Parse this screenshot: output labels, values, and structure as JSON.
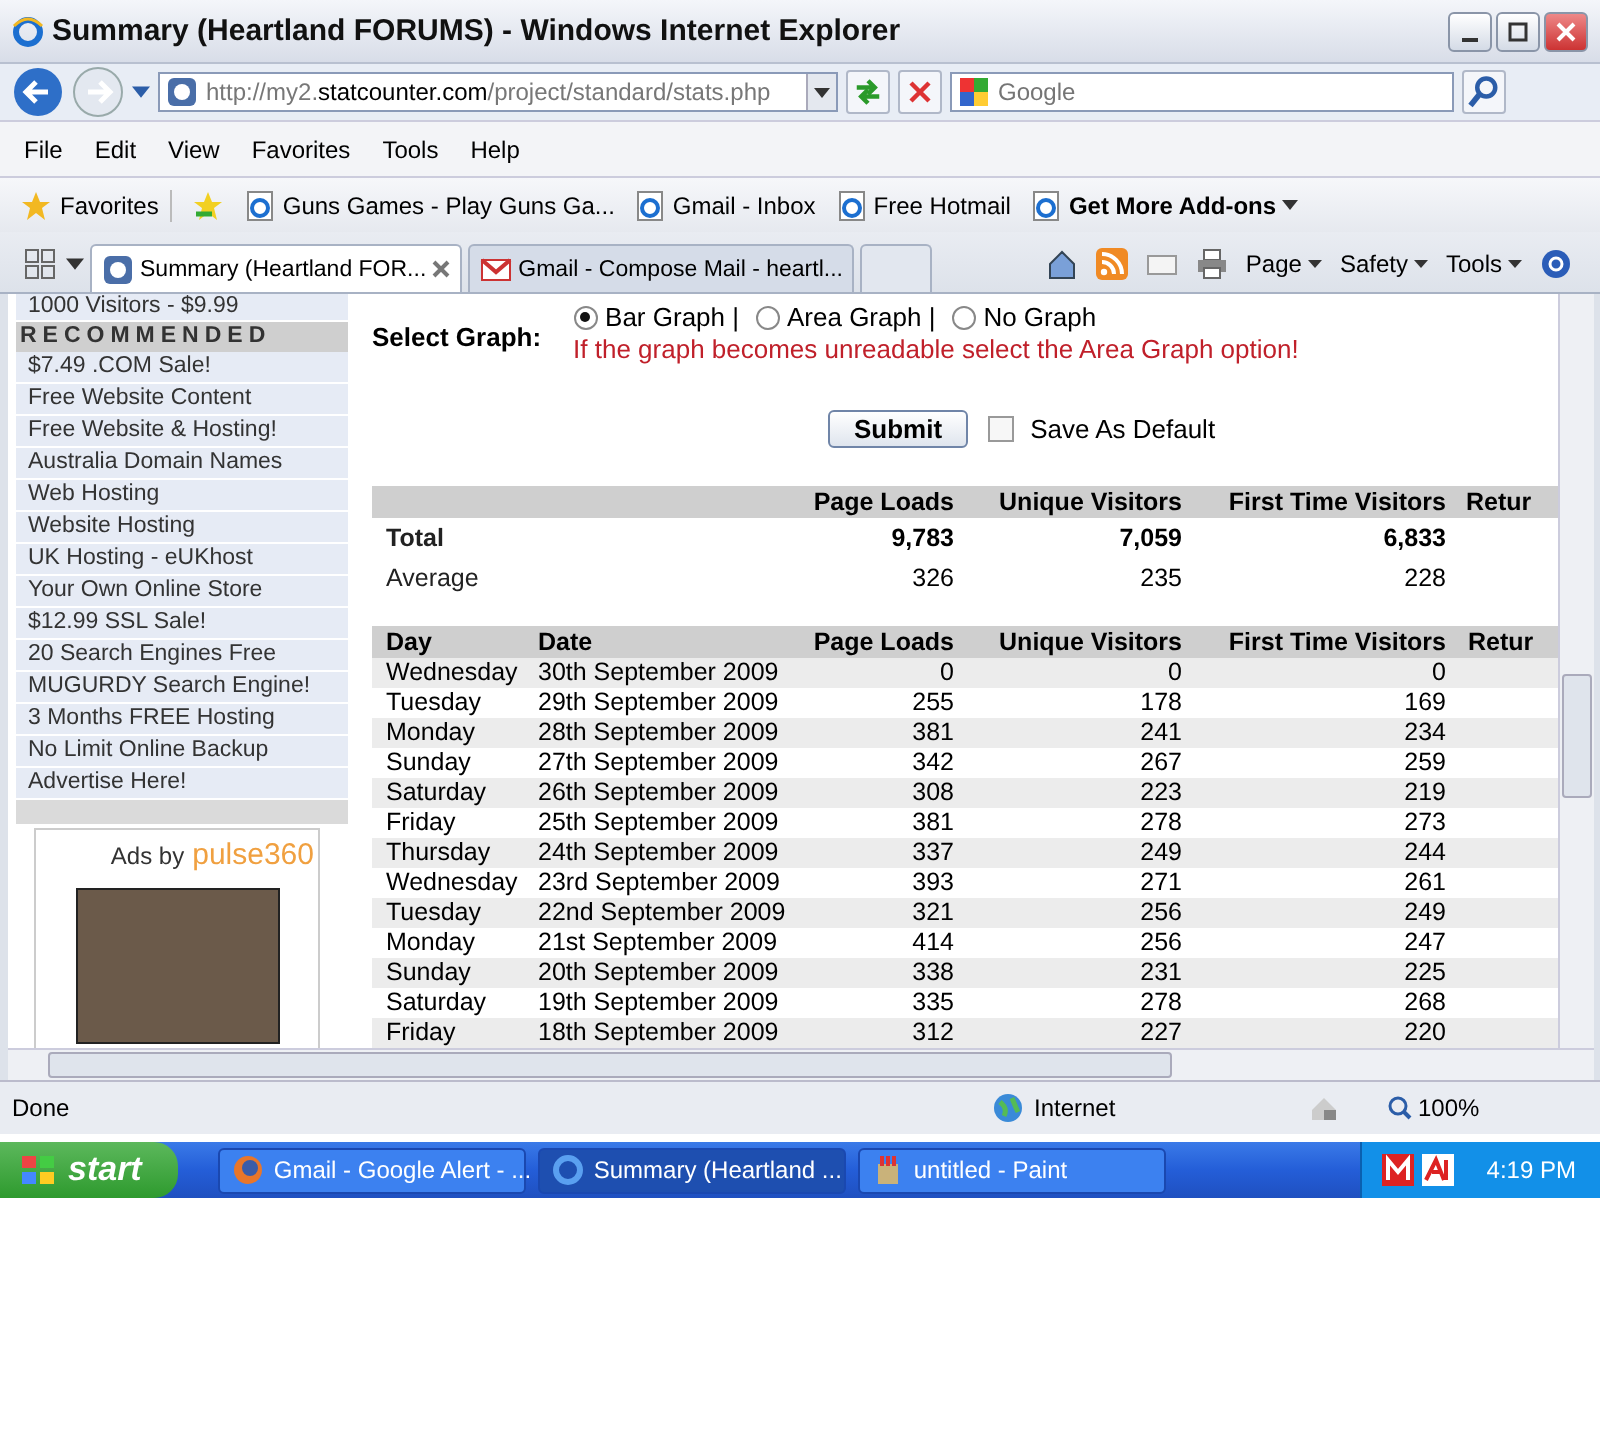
{
  "window": {
    "title": "Summary (Heartland FORUMS) - Windows Internet Explorer"
  },
  "address_bar": {
    "url_prefix": "http://my2.",
    "url_domain": "statcounter.com",
    "url_path": "/project/standard/stats.php"
  },
  "search": {
    "placeholder": "Google"
  },
  "menu": [
    "File",
    "Edit",
    "View",
    "Favorites",
    "Tools",
    "Help"
  ],
  "favorites_bar": {
    "label": "Favorites",
    "items": [
      {
        "label": "Guns Games - Play Guns Ga...",
        "kind": "link"
      },
      {
        "label": "Gmail - Inbox",
        "kind": "link"
      },
      {
        "label": "Free Hotmail",
        "kind": "link"
      },
      {
        "label": "Get More Add-ons",
        "kind": "menu"
      }
    ]
  },
  "tabs": [
    {
      "label": "Summary (Heartland FOR...",
      "selected": true,
      "kind": "stat"
    },
    {
      "label": "Gmail - Compose Mail - heartl...",
      "selected": false,
      "kind": "mail"
    }
  ],
  "command_bar": [
    "Page",
    "Safety",
    "Tools"
  ],
  "sidebar": {
    "top_item": "1000 Visitors - $9.99",
    "heading": "RECOMMENDED",
    "items": [
      "$7.49 .COM Sale!",
      "Free Website Content",
      "Free Website & Hosting!",
      "Australia Domain Names",
      "Web Hosting",
      "Website Hosting",
      "UK Hosting - eUKhost",
      "Your Own Online Store",
      "$12.99 SSL Sale!",
      "20 Search Engines Free",
      "MUGURDY Search Engine!",
      "3 Months FREE Hosting",
      "No Limit Online Backup",
      "Advertise Here!"
    ],
    "ad_label": "Ads by",
    "ad_brand": "pulse360"
  },
  "graph_form": {
    "label": "Select Graph:",
    "options": [
      {
        "label": "Bar Graph |",
        "selected": true
      },
      {
        "label": "Area Graph |",
        "selected": false
      },
      {
        "label": "No Graph",
        "selected": false
      }
    ],
    "warning": "If the graph becomes unreadable select the Area Graph option!",
    "submit": "Submit",
    "save_default": {
      "label": "Save As Default",
      "checked": false
    }
  },
  "summary_table": {
    "columns": [
      "Page Loads",
      "Unique Visitors",
      "First Time Visitors",
      "Retur"
    ],
    "rows": [
      {
        "label": "Total",
        "values": [
          "9,783",
          "7,059",
          "6,833"
        ],
        "bold": true
      },
      {
        "label": "Average",
        "values": [
          "326",
          "235",
          "228"
        ],
        "bold": false
      }
    ]
  },
  "daily_table": {
    "columns": [
      "Day",
      "Date",
      "Page Loads",
      "Unique Visitors",
      "First Time Visitors",
      "Retur"
    ],
    "rows": [
      [
        "Wednesday",
        "30th September 2009",
        "0",
        "0",
        "0"
      ],
      [
        "Tuesday",
        "29th September 2009",
        "255",
        "178",
        "169"
      ],
      [
        "Monday",
        "28th September 2009",
        "381",
        "241",
        "234"
      ],
      [
        "Sunday",
        "27th September 2009",
        "342",
        "267",
        "259"
      ],
      [
        "Saturday",
        "26th September 2009",
        "308",
        "223",
        "219"
      ],
      [
        "Friday",
        "25th September 2009",
        "381",
        "278",
        "273"
      ],
      [
        "Thursday",
        "24th September 2009",
        "337",
        "249",
        "244"
      ],
      [
        "Wednesday",
        "23rd September 2009",
        "393",
        "271",
        "261"
      ],
      [
        "Tuesday",
        "22nd September 2009",
        "321",
        "256",
        "249"
      ],
      [
        "Monday",
        "21st September 2009",
        "414",
        "256",
        "247"
      ],
      [
        "Sunday",
        "20th September 2009",
        "338",
        "231",
        "225"
      ],
      [
        "Saturday",
        "19th September 2009",
        "335",
        "278",
        "268"
      ],
      [
        "Friday",
        "18th September 2009",
        "312",
        "227",
        "220"
      ]
    ]
  },
  "status_bar": {
    "text": "Done",
    "zone": "Internet",
    "zoom": "100%"
  },
  "taskbar": {
    "start": "start",
    "items": [
      {
        "label": "Gmail - Google Alert - ...",
        "selected": false,
        "kind": "firefox"
      },
      {
        "label": "Summary (Heartland ...",
        "selected": true,
        "kind": "ie"
      },
      {
        "label": "untitled - Paint",
        "selected": false,
        "kind": "paint"
      }
    ],
    "clock": "4:19 PM"
  }
}
